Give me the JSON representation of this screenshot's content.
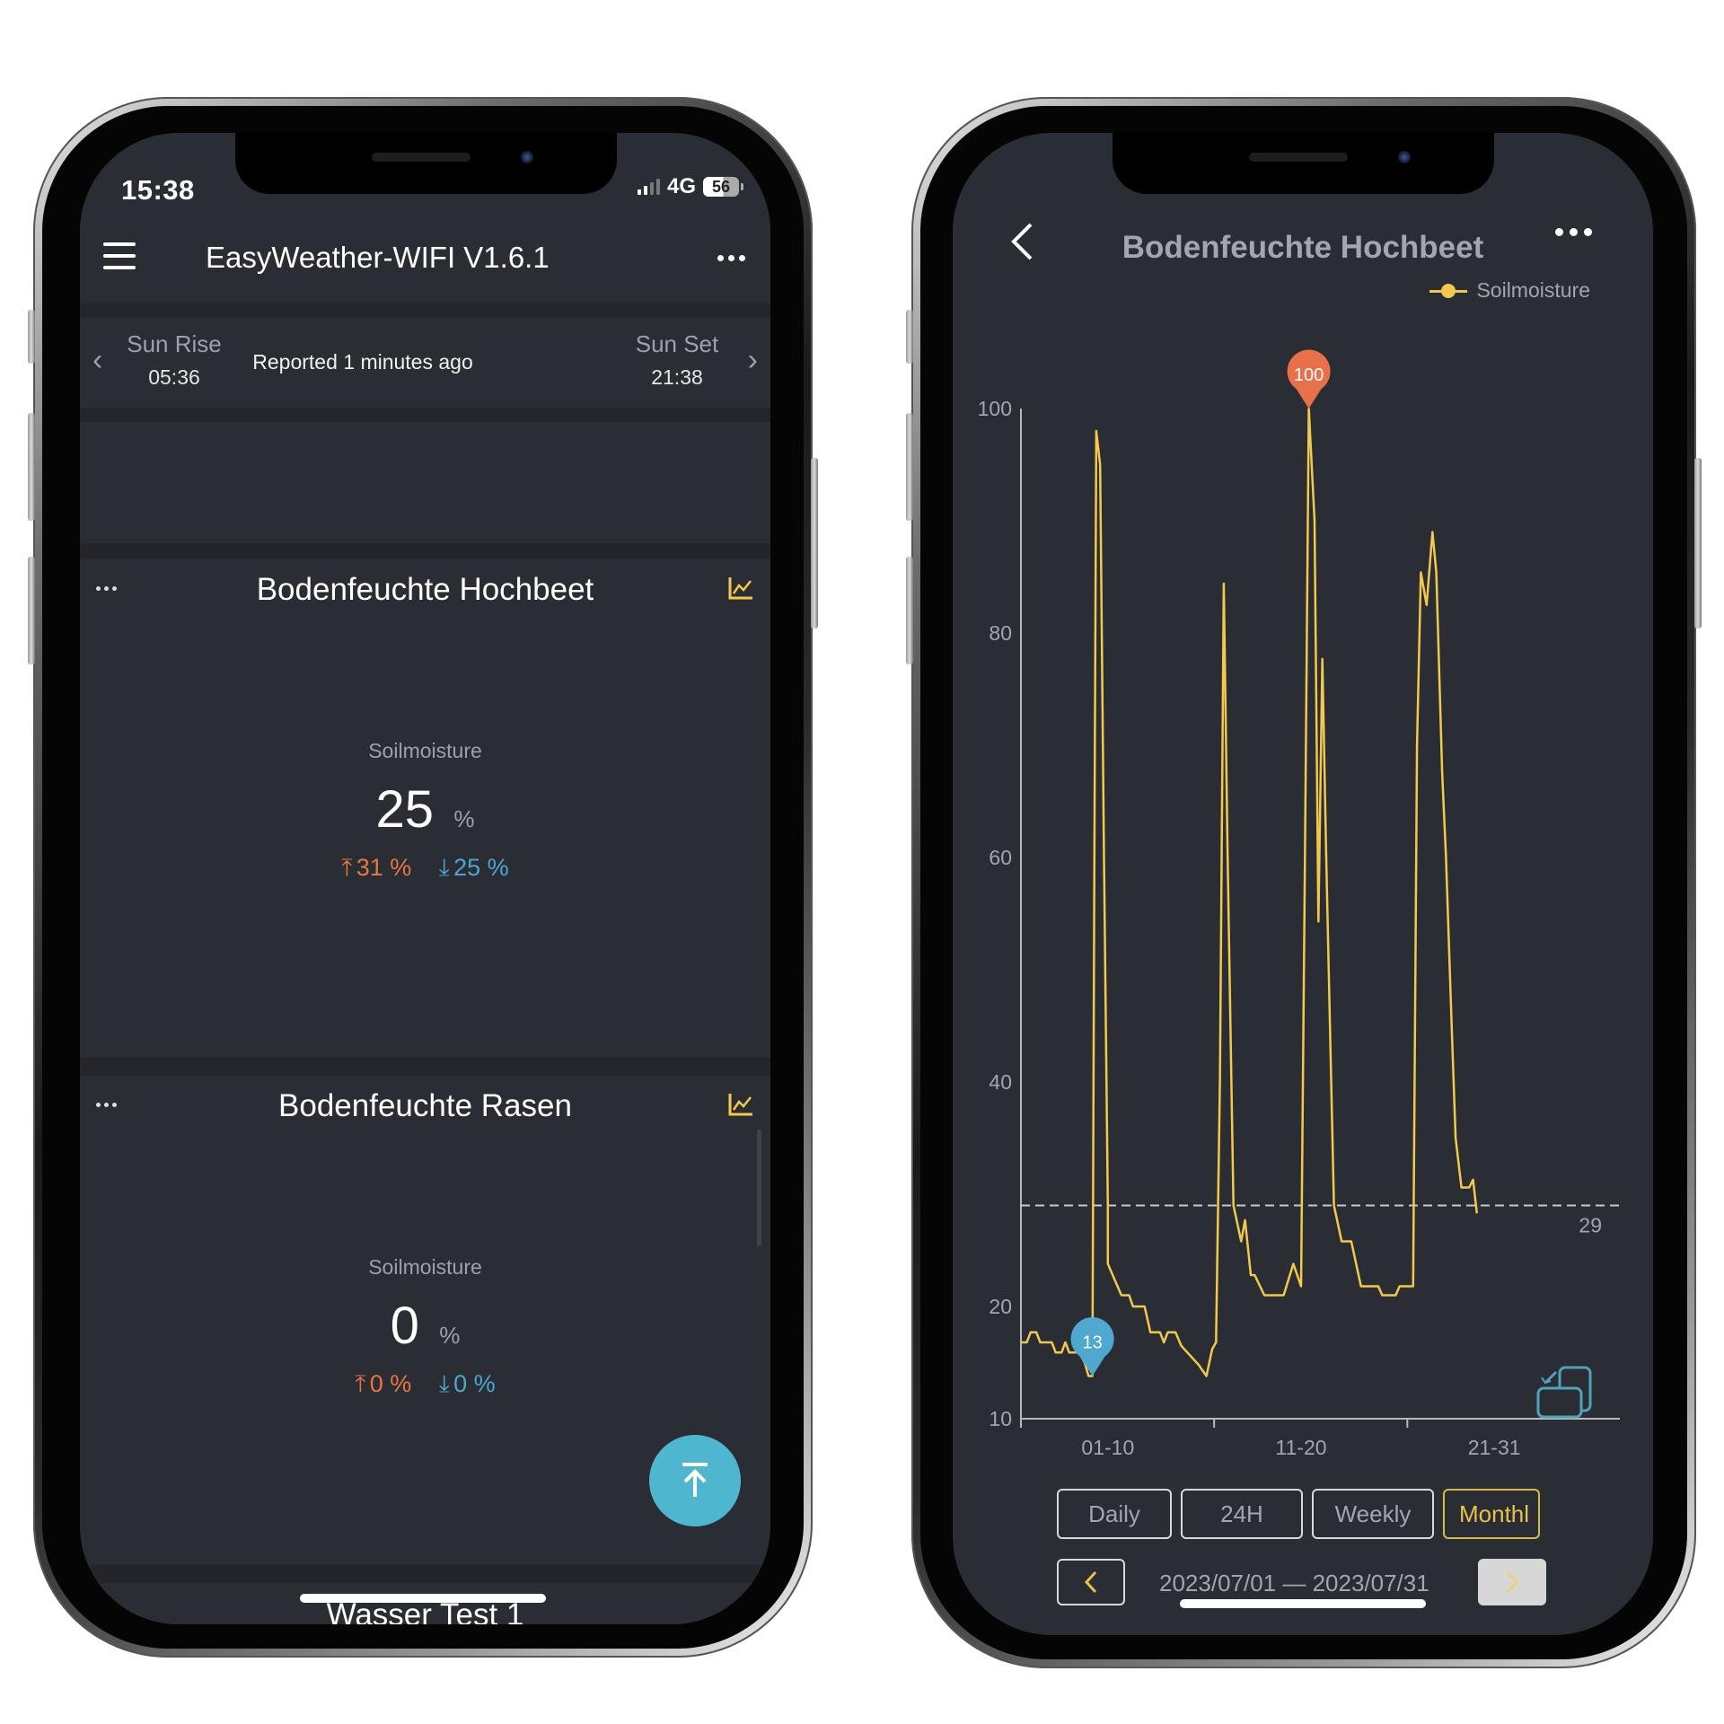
{
  "left_phone": {
    "status_bar": {
      "time": "15:38",
      "network": "4G",
      "battery": "56"
    },
    "header": {
      "title": "EasyWeather-WIFI V1.6.1",
      "menu_icon": "hamburger-icon",
      "more_icon": "more-dots-icon"
    },
    "sun_row": {
      "sunrise_label": "Sun Rise",
      "sunrise_time": "05:36",
      "reported": "Reported 1 minutes ago",
      "sunset_label": "Sun Set",
      "sunset_time": "21:38"
    },
    "cards": [
      {
        "title": "Bodenfeuchte Hochbeet",
        "metric_label": "Soilmoisture",
        "value": "25",
        "unit": "%",
        "high": "31 %",
        "low": "25 %"
      },
      {
        "title": "Bodenfeuchte Rasen",
        "metric_label": "Soilmoisture",
        "value": "0",
        "unit": "%",
        "high": "0 %",
        "low": "0 %"
      },
      {
        "title": "Wasser Test 1"
      }
    ],
    "fab_icon": "scroll-to-top-icon"
  },
  "right_phone": {
    "title": "Bodenfeuchte Hochbeet",
    "legend": "Soilmoisture",
    "range_buttons": [
      "Daily",
      "24H",
      "Weekly",
      "Monthl"
    ],
    "active_range": "Monthl",
    "date_range": "2023/07/01 — 2023/07/31",
    "colors": {
      "line": "#f2c94c",
      "max_marker": "#e8714a",
      "min_marker": "#4ea8cf",
      "active": "#e7c24a"
    }
  },
  "chart_data": {
    "type": "line",
    "title": "Bodenfeuchte Hochbeet",
    "xlabel": "",
    "ylabel": "",
    "series": [
      {
        "name": "Soilmoisture",
        "points": [
          [
            0.0,
            16.8
          ],
          [
            0.3,
            16.8
          ],
          [
            0.5,
            17.7
          ],
          [
            0.8,
            17.7
          ],
          [
            1.0,
            16.8
          ],
          [
            1.6,
            16.8
          ],
          [
            1.8,
            15.9
          ],
          [
            2.1,
            15.9
          ],
          [
            2.3,
            16.8
          ],
          [
            2.5,
            15.9
          ],
          [
            3.0,
            15.9
          ],
          [
            3.3,
            15.0
          ],
          [
            3.5,
            13.8
          ],
          [
            3.7,
            13.8
          ],
          [
            3.8,
            60
          ],
          [
            3.9,
            98
          ],
          [
            4.1,
            95
          ],
          [
            4.3,
            60
          ],
          [
            4.5,
            29
          ],
          [
            4.5,
            23.8
          ],
          [
            4.7,
            23.0
          ],
          [
            4.9,
            22.2
          ],
          [
            5.2,
            21.0
          ],
          [
            5.6,
            21.0
          ],
          [
            5.8,
            20.0
          ],
          [
            6.4,
            20.0
          ],
          [
            6.7,
            17.7
          ],
          [
            7.2,
            17.7
          ],
          [
            7.4,
            16.8
          ],
          [
            7.6,
            17.7
          ],
          [
            8.0,
            17.7
          ],
          [
            8.3,
            16.5
          ],
          [
            9.2,
            14.8
          ],
          [
            9.6,
            13.8
          ],
          [
            9.9,
            16.2
          ],
          [
            10.1,
            16.8
          ],
          [
            10.3,
            40
          ],
          [
            10.5,
            84.4
          ],
          [
            10.7,
            60
          ],
          [
            11.0,
            29
          ],
          [
            11.4,
            25.8
          ],
          [
            11.6,
            27.7
          ],
          [
            11.9,
            22.8
          ],
          [
            12.1,
            22.8
          ],
          [
            12.6,
            21.0
          ],
          [
            13.6,
            21.0
          ],
          [
            14.1,
            23.8
          ],
          [
            14.5,
            21.8
          ],
          [
            14.7,
            60
          ],
          [
            14.9,
            100
          ],
          [
            15.2,
            90
          ],
          [
            15.4,
            54.3
          ],
          [
            15.6,
            77.7
          ],
          [
            15.8,
            60
          ],
          [
            16.2,
            29
          ],
          [
            16.6,
            25.8
          ],
          [
            17.1,
            25.8
          ],
          [
            17.6,
            21.8
          ],
          [
            18.5,
            21.8
          ],
          [
            18.7,
            21.0
          ],
          [
            19.4,
            21.0
          ],
          [
            19.6,
            21.8
          ],
          [
            20.3,
            21.8
          ],
          [
            20.5,
            70
          ],
          [
            20.7,
            85.4
          ],
          [
            21.0,
            82.5
          ],
          [
            21.3,
            89.0
          ],
          [
            21.5,
            85.4
          ],
          [
            21.8,
            67.6
          ],
          [
            22.0,
            60
          ],
          [
            22.3,
            44.8
          ],
          [
            22.5,
            35
          ],
          [
            22.8,
            30.6
          ],
          [
            23.2,
            30.6
          ],
          [
            23.4,
            31.3
          ],
          [
            23.6,
            28.3
          ]
        ]
      }
    ],
    "x_tick_labels": [
      "01-10",
      "11-20",
      "21-31"
    ],
    "x_range": [
      0,
      31
    ],
    "y_ticks": [
      10,
      20,
      40,
      60,
      80,
      100
    ],
    "ylim": [
      10,
      100
    ],
    "average_line": {
      "value": 29,
      "label": "29",
      "style": "dashed"
    },
    "markers": [
      {
        "type": "max",
        "label": "100",
        "x": 14.9,
        "y": 100
      },
      {
        "type": "min",
        "label": "13",
        "x": 3.7,
        "y": 13.8
      }
    ],
    "grid": false,
    "legend": "top-right"
  }
}
